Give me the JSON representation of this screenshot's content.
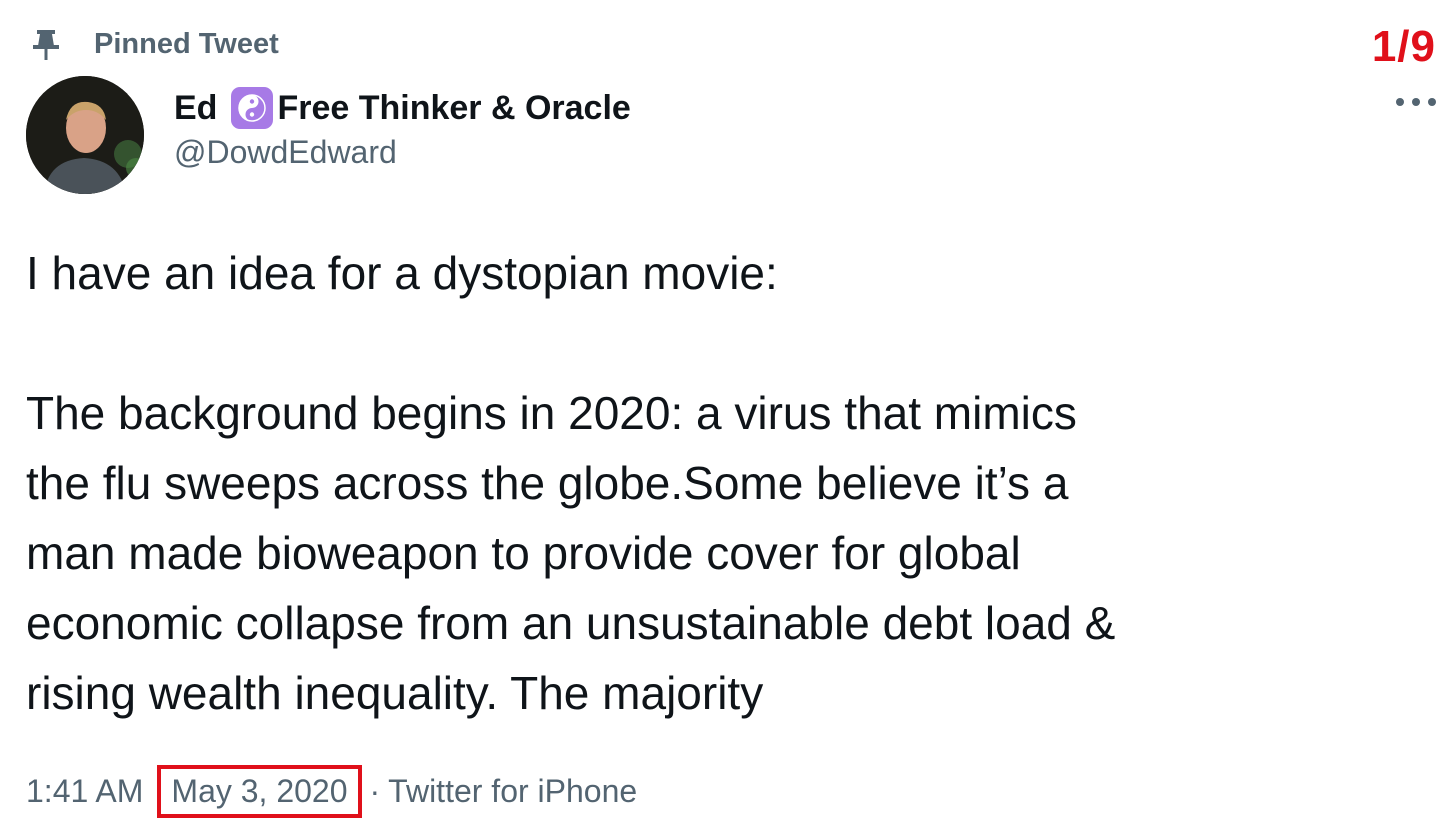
{
  "pinned": {
    "label": "Pinned Tweet",
    "icon": "pin-icon"
  },
  "thread_counter": "1/9",
  "author": {
    "name": "Ed",
    "badge_icon": "yin-yang-icon",
    "name_suffix": "Free Thinker & Oracle",
    "handle": "@DowdEdward"
  },
  "more_icon": "more-icon",
  "tweet": {
    "line1": "I have an idea for a dystopian movie:",
    "paragraph2": [
      "The background begins in 2020: a virus that mimics",
      "the flu sweeps across the globe.Some believe it’s a",
      "man made bioweapon to provide cover for global",
      "economic collapse from an unsustainable debt load &",
      "rising wealth inequality. The majority"
    ]
  },
  "meta": {
    "time": "1:41 AM",
    "date": "May 3, 2020",
    "separator": "·",
    "source": "Twitter for iPhone"
  },
  "colors": {
    "highlight_red": "#e0101a",
    "secondary_text": "#536471",
    "badge_purple": "#a77ae6"
  }
}
